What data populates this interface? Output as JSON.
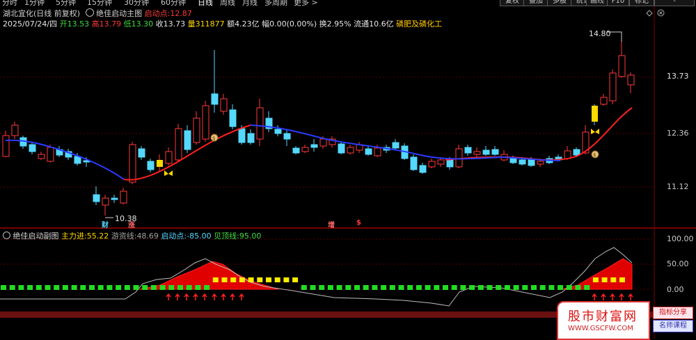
{
  "toolbar": {
    "periods": [
      {
        "label": "分时"
      },
      {
        "label": "1分钟"
      },
      {
        "label": "5分钟"
      },
      {
        "label": "15分钟"
      },
      {
        "label": "30分钟"
      },
      {
        "label": "60分钟"
      },
      {
        "label": "日线"
      },
      {
        "label": "周线"
      },
      {
        "label": "月线"
      },
      {
        "label": "多周期"
      },
      {
        "label": "更多 >"
      }
    ],
    "active_period": "日线",
    "right_buttons": [
      {
        "label": "复权"
      },
      {
        "label": "叠加"
      },
      {
        "label": "多股"
      },
      {
        "label": "统计"
      },
      {
        "label": "画线"
      },
      {
        "label": "F10"
      },
      {
        "label": "标记"
      },
      {
        "label": "-"
      }
    ]
  },
  "main_chart": {
    "stock_title": "湖北宜化(日线 前复权)",
    "indicator_icon": "gear-icon",
    "indicator_name": "绝佳启动主图",
    "qidong_label": "启动点:",
    "qidong_value": "12.87",
    "date": "2025/07/24/四",
    "open_label": "开",
    "open": "13.53",
    "high_label": "高",
    "high": "13.79",
    "low_label": "低",
    "low": "13.30",
    "close_label": "收",
    "close": "13.73",
    "volume_label": "量",
    "volume": "311877",
    "amount_label": "额",
    "amount": "4.23亿",
    "change_label": "幅",
    "change": "0.00(0.00%)",
    "turnover_label": "换",
    "turnover": "2.95%",
    "float_label": "流通",
    "float": "10.6亿",
    "sector": "磷肥及磷化工",
    "y_ticks": [
      "13.73",
      "12.36",
      "11.12"
    ],
    "max_label": "14.80",
    "min_label": "10.38",
    "event_marks": [
      {
        "label": "财",
        "color": "#54d8ff"
      },
      {
        "label": "涨",
        "color": "#ff6a6a"
      },
      {
        "label": "增",
        "color": "#ff6a6a"
      },
      {
        "label": "$",
        "color": "#ff3a3a"
      }
    ],
    "icons": [
      "butterfly-icon",
      "moneybag-icon"
    ]
  },
  "sub_chart": {
    "name": "绝佳启动副图",
    "series": [
      {
        "label": "主力进:",
        "value": "55.22",
        "color": "#ffd800"
      },
      {
        "label": "游资线:",
        "value": "48.69",
        "color": "#a0a0a0"
      },
      {
        "label": "启动点:",
        "value": "-85.00",
        "color": "#54d8ff"
      },
      {
        "label": "见顶线:",
        "value": "95.00",
        "color": "#3ddc3d"
      }
    ],
    "y_ticks": [
      "100.00",
      "50.00",
      "0.00"
    ]
  },
  "watermark": {
    "name": "股市财富网",
    "url": "WWW.GSCFW.COM",
    "tag1": "指标分享",
    "tag2": "名师课程"
  },
  "colors": {
    "up": "#ff3a3a",
    "down": "#54d8ff",
    "ma_up": "#ff2020",
    "ma_down": "#2a3cff",
    "signal_green": "#22dd22",
    "signal_yellow": "#ffee00",
    "area_red": "#e00000"
  }
}
